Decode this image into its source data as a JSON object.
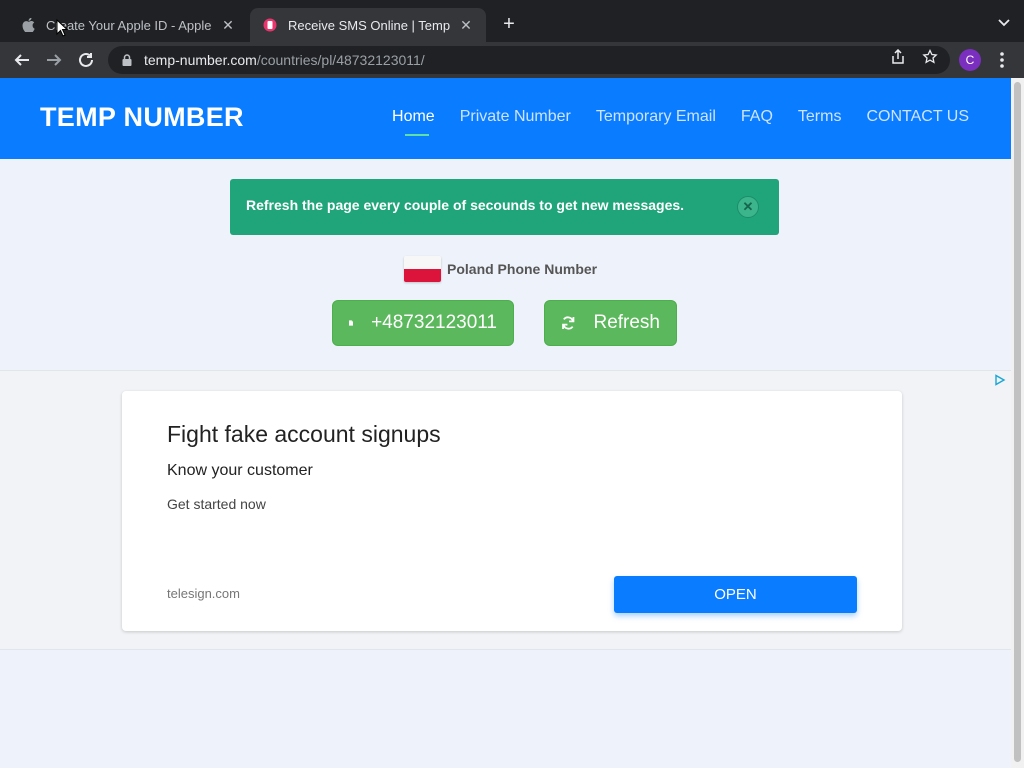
{
  "browser": {
    "tabs": [
      {
        "title": "Create Your Apple ID - Apple",
        "active": false,
        "favicon": "apple-icon"
      },
      {
        "title": "Receive SMS Online | Tempora",
        "active": true,
        "favicon": "temp-number-favicon"
      }
    ],
    "url_host": "temp-number.com",
    "url_path": "/countries/pl/48732123011/",
    "profile_initial": "C"
  },
  "site": {
    "brand": "TEMP NUMBER",
    "nav": [
      {
        "label": "Home",
        "active": true
      },
      {
        "label": "Private Number",
        "active": false
      },
      {
        "label": "Temporary Email",
        "active": false
      },
      {
        "label": "FAQ",
        "active": false
      },
      {
        "label": "Terms",
        "active": false
      },
      {
        "label": "CONTACT US",
        "active": false
      }
    ],
    "accent_color": "#0a7cff"
  },
  "alert": {
    "message": "Refresh the page every couple of secounds to get new messages.",
    "close_glyph": "✕"
  },
  "country": {
    "label": "Poland Phone Number",
    "flag": "poland-flag"
  },
  "actions": {
    "number_label": "+48732123011",
    "refresh_label": "Refresh"
  },
  "ad": {
    "headline": "Fight fake account signups",
    "subhead": "Know your customer",
    "description": "Get started now",
    "domain": "telesign.com",
    "cta": "OPEN"
  }
}
